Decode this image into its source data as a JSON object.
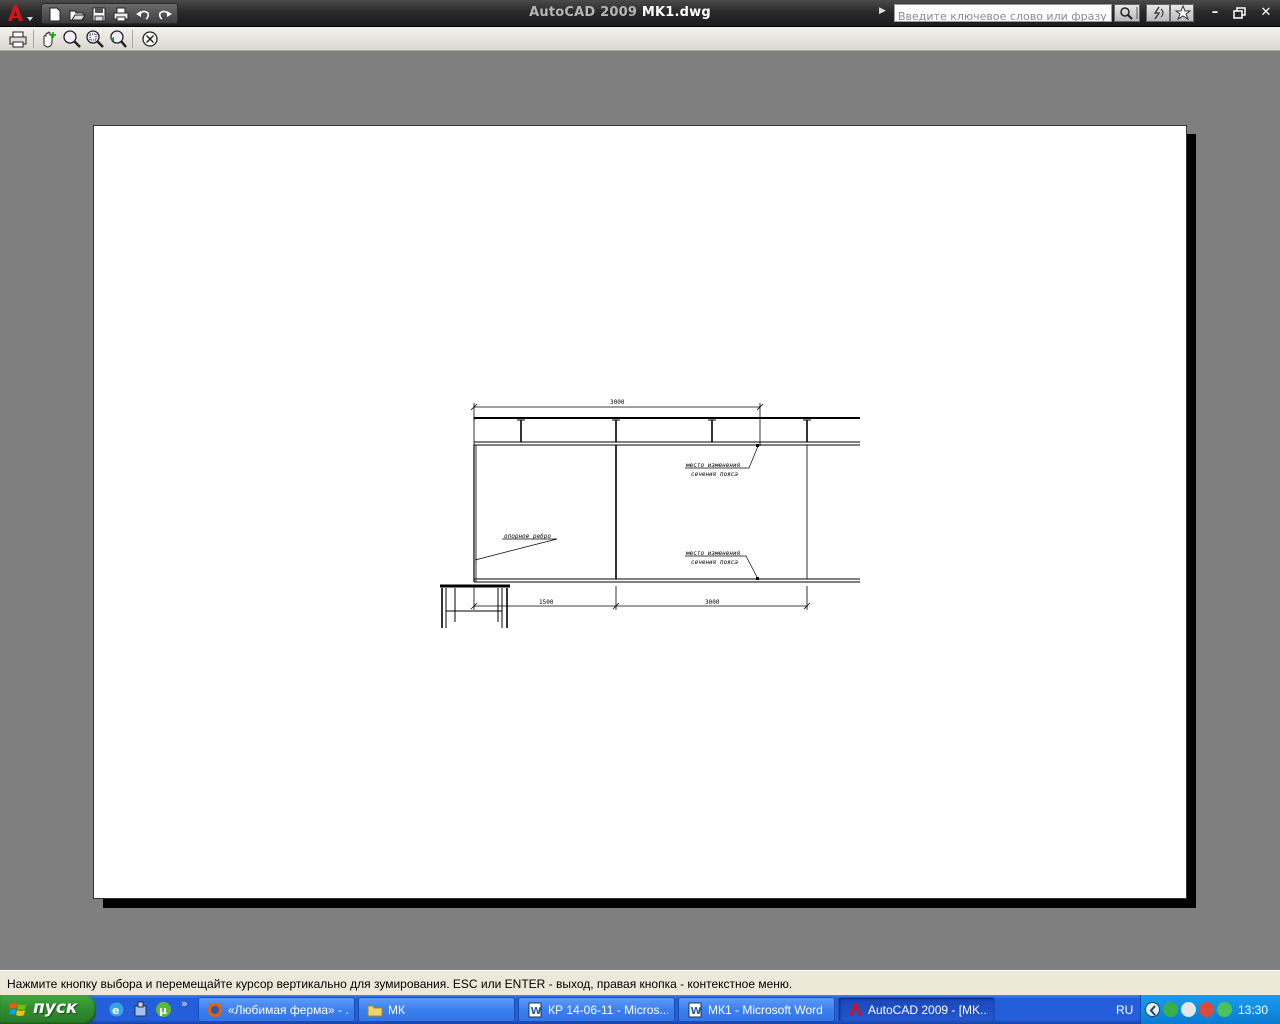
{
  "window": {
    "title_app": "AutoCAD 2009",
    "title_doc": "MK1.dwg",
    "search_placeholder": "Введите ключевое слово или фразу"
  },
  "quick_access_icons": [
    "new-icon",
    "open-icon",
    "save-icon",
    "plot-icon",
    "undo-icon",
    "redo-icon"
  ],
  "toolbar_icons": [
    "plot-icon",
    "pan-icon",
    "zoom-realtime-icon",
    "zoom-window-icon",
    "zoom-previous-icon",
    "close-preview-icon"
  ],
  "drawing": {
    "dim_top": "3000",
    "dim_bottom_left": "1500",
    "dim_bottom_right": "3000",
    "note_top_line1": "место изменения",
    "note_top_line2": "сечения пояса",
    "note_support_rib": "опорное ребро",
    "note_bottom_line1": "место изменения",
    "note_bottom_line2": "сечения пояса"
  },
  "command_line": "Нажмите кнопку выбора и перемещайте курсор вертикально для зумирования. ESC или ENTER - выход, правая кнопка - контекстное меню.",
  "taskbar": {
    "start_label": "пуск",
    "tasks": [
      {
        "label": "«Любимая ферма» - ...",
        "icon": "firefox-icon",
        "active": false
      },
      {
        "label": "МК",
        "icon": "folder-icon",
        "active": false
      },
      {
        "label": "КР 14-06-11 - Micros...",
        "icon": "word-icon",
        "active": false
      },
      {
        "label": "МК1 - Microsoft Word",
        "icon": "word-icon",
        "active": false
      },
      {
        "label": "AutoCAD 2009 - [MK...",
        "icon": "autocad-icon",
        "active": true
      }
    ],
    "language": "RU",
    "clock": "13:30"
  },
  "colors": {
    "canvas_bg": "#7f7f7f",
    "titlebar": "#2a2a2a",
    "taskbar": "#245edb",
    "start_button": "#2f8c2f"
  }
}
